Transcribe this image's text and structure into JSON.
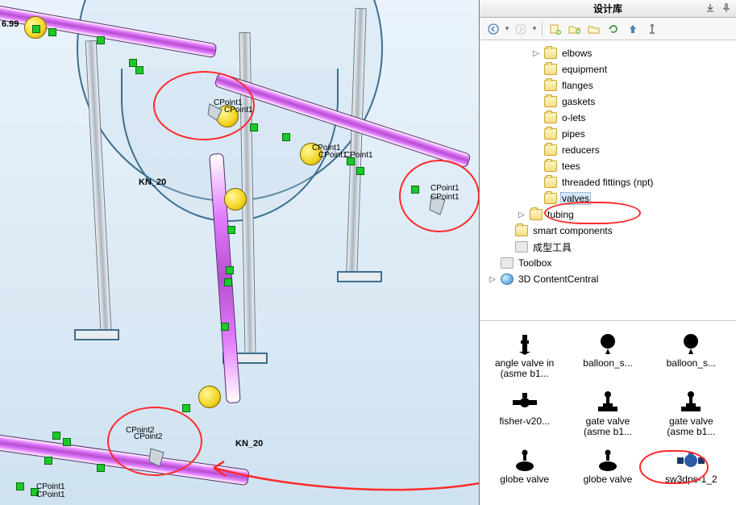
{
  "panel": {
    "title": "设计库",
    "toolbar_icons": [
      "back",
      "forward",
      "add-file",
      "add-folder",
      "open-folder",
      "refresh",
      "up",
      "options"
    ]
  },
  "tree": [
    {
      "label": "elbows",
      "icon": "folder",
      "expander": "right",
      "depth": 3
    },
    {
      "label": "equipment",
      "icon": "folder",
      "expander": "none",
      "depth": 3
    },
    {
      "label": "flanges",
      "icon": "folder",
      "expander": "none",
      "depth": 3
    },
    {
      "label": "gaskets",
      "icon": "folder",
      "expander": "none",
      "depth": 3
    },
    {
      "label": "o-lets",
      "icon": "folder",
      "expander": "none",
      "depth": 3
    },
    {
      "label": "pipes",
      "icon": "folder",
      "expander": "none",
      "depth": 3
    },
    {
      "label": "reducers",
      "icon": "folder",
      "expander": "none",
      "depth": 3
    },
    {
      "label": "tees",
      "icon": "folder",
      "expander": "none",
      "depth": 3
    },
    {
      "label": "threaded fittings (npt)",
      "icon": "folder",
      "expander": "none",
      "depth": 3
    },
    {
      "label": "valves",
      "icon": "folder",
      "expander": "none",
      "depth": 3,
      "selected": true
    },
    {
      "label": "tubing",
      "icon": "folder",
      "expander": "right",
      "depth": 2
    },
    {
      "label": "smart components",
      "icon": "folder",
      "expander": "none",
      "depth": 1
    },
    {
      "label": "成型工具",
      "icon": "tool",
      "expander": "none",
      "depth": 1
    },
    {
      "label": "Toolbox",
      "icon": "tool",
      "expander": "none",
      "depth": 0
    },
    {
      "label": "3D ContentCentral",
      "icon": "globe",
      "expander": "right",
      "depth": 0
    }
  ],
  "thumbs": [
    {
      "label": "angle valve in",
      "sub": "(asme b1...",
      "icon": "angle-valve"
    },
    {
      "label": "balloon_s...",
      "sub": "",
      "icon": "balloon"
    },
    {
      "label": "balloon_s...",
      "sub": "",
      "icon": "balloon"
    },
    {
      "label": "fisher-v20...",
      "sub": "",
      "icon": "fisher"
    },
    {
      "label": "gate valve",
      "sub": "(asme b1...",
      "icon": "gate"
    },
    {
      "label": "gate valve",
      "sub": "(asme b1...",
      "icon": "gate"
    },
    {
      "label": "globe valve",
      "sub": "",
      "icon": "globe-v"
    },
    {
      "label": "globe valve",
      "sub": "",
      "icon": "globe-v"
    },
    {
      "label": "sw3dps-1_2",
      "sub": "",
      "icon": "ball-valve",
      "highlighted": true
    }
  ],
  "viewport_labels": {
    "coord_left": "6.99",
    "dim_a": "KN_20",
    "dim_b": "KN_20",
    "pt1a": "CPoint1",
    "pt1b": "CPoint1",
    "pt2a": "CPoint1",
    "pt2b": "CPoint1",
    "pt2c": "CPoint1",
    "pt3a": "CPoint1",
    "pt3b": "CPoint1",
    "pt4a": "CPoint2",
    "pt4b": "CPoint2",
    "pt5a": "CPoint1",
    "pt5b": "CPoint1"
  }
}
